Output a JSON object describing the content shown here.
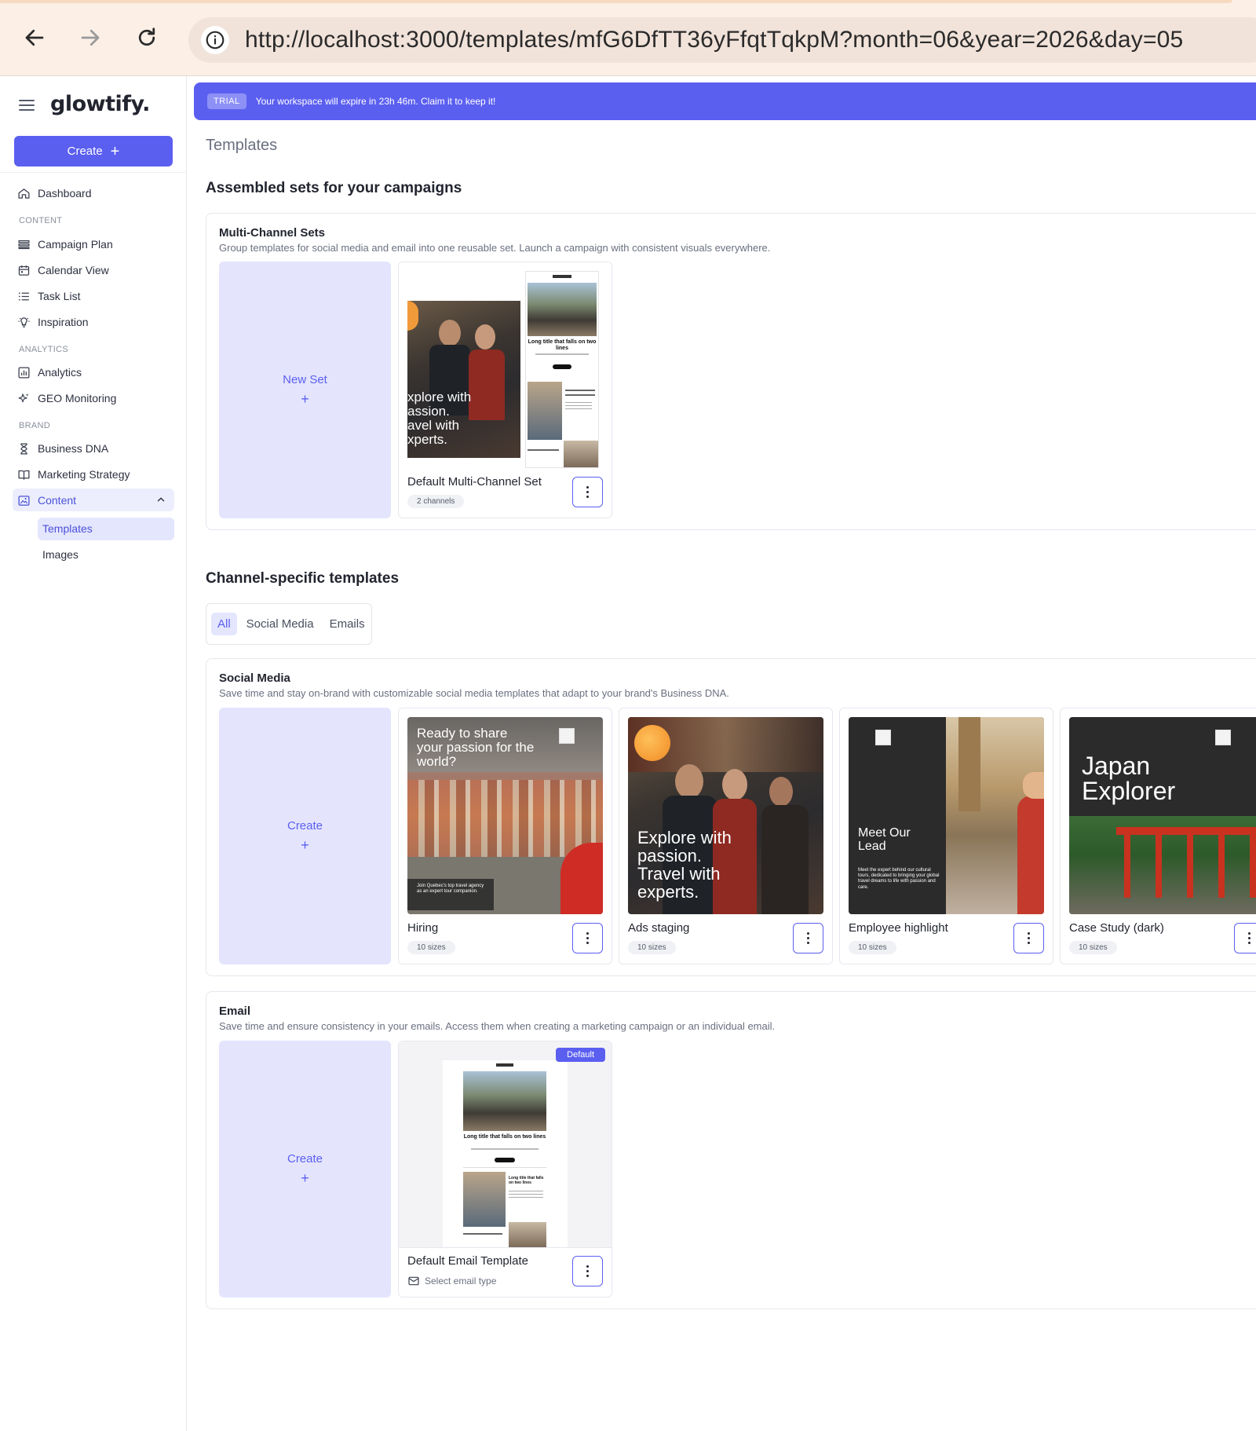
{
  "browser": {
    "url": "http://localhost:3000/templates/mfG6DfTT36yFfqtTqkpM?month=06&year=2026&day=05"
  },
  "sidebar": {
    "logo": "glowtify.",
    "create_label": "Create",
    "dashboard": "Dashboard",
    "content_label": "CONTENT",
    "campaign_plan": "Campaign Plan",
    "calendar_view": "Calendar View",
    "task_list": "Task List",
    "inspiration": "Inspiration",
    "analytics_label": "ANALYTICS",
    "analytics": "Analytics",
    "geo_monitoring": "GEO Monitoring",
    "brand_label": "BRAND",
    "business_dna": "Business DNA",
    "marketing_strategy": "Marketing Strategy",
    "content": "Content",
    "templates": "Templates",
    "images": "Images"
  },
  "trial": {
    "badge": "TRIAL",
    "text": "Your workspace will expire in 23h 46m. Claim it to keep it!"
  },
  "page": {
    "title": "Templates",
    "sets_heading": "Assembled sets for your campaigns",
    "channel_heading": "Channel-specific templates"
  },
  "multichannel": {
    "title": "Multi-Channel Sets",
    "description": "Group templates for social media and email into one reusable set. Launch a campaign with consistent visuals everywhere.",
    "new_label": "New Set",
    "plus": "+",
    "card": {
      "name": "Default Multi-Channel Set",
      "badge": "2 channels",
      "thumb_text": "xplore with\nassion.\navel with\nxperts.",
      "email_headline": "Long title that falls on two lines"
    }
  },
  "tabs": {
    "all": "All",
    "social": "Social Media",
    "emails": "Emails"
  },
  "social": {
    "title": "Social Media",
    "description": "Save time and stay on-brand with customizable social media templates that adapt to your brand's Business DNA.",
    "create_label": "Create",
    "plus": "+",
    "cards": [
      {
        "name": "Hiring",
        "badge": "10 sizes",
        "headline": "Ready to share your passion for the world?",
        "caption": "Join Quebec's top travel agency as an expert tour companion."
      },
      {
        "name": "Ads staging",
        "badge": "10 sizes",
        "headline": "Explore with passion. Travel with experts."
      },
      {
        "name": "Employee highlight",
        "badge": "10 sizes",
        "headline": "Meet Our Lead",
        "caption": "Meet the expert behind our cultural tours, dedicated to bringing your global travel dreams to life with passion and care."
      },
      {
        "name": "Case Study (dark)",
        "badge": "10 sizes",
        "headline": "Japan Explorer"
      }
    ]
  },
  "email": {
    "title": "Email",
    "description": "Save time and ensure consistency in your emails. Access them when creating a marketing campaign or an individual email.",
    "create_label": "Create",
    "plus": "+",
    "card": {
      "name": "Default Email Template",
      "default_badge": "Default",
      "type_label": "Select email type",
      "headline": "Long title that falls on two lines",
      "sub_headline": "Long title that falls on two lines"
    }
  },
  "colors": {
    "accent": "#5b5ff0",
    "accent_light": "#e4e5fd",
    "browser_bg": "#fcefe6"
  }
}
